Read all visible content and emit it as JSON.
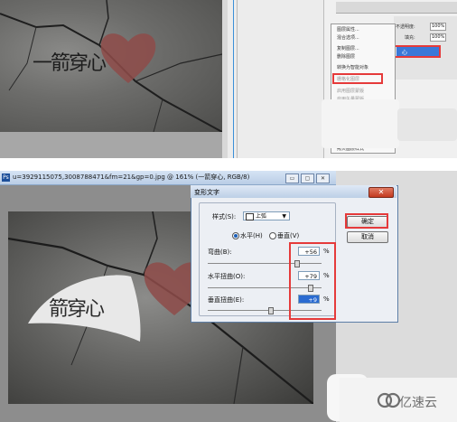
{
  "top": {
    "logo_text": "一箭穿心",
    "context_menu": {
      "items": [
        "图层属性...",
        "混合选项...",
        "复制图层...",
        "删除图层",
        "转换为智能对象",
        "栅格化图层",
        "启用图层蒙版",
        "启用矢量蒙版"
      ],
      "highlighted_item": "栅格化图层",
      "bottom_item": "拷贝图层样式"
    },
    "layers_panel": {
      "opacity_label": "不透明度:",
      "opacity_value": "100%",
      "fill_label": "填充:",
      "fill_value": "100%",
      "selected_layer": "心"
    }
  },
  "document": {
    "title": "u=3929115075,3008788471&fm=21&gp=0.jpg @ 161% (一箭穿心, RGB/8)",
    "window_buttons": [
      "▭",
      "▢",
      "✕"
    ],
    "logo_text": "箭穿心"
  },
  "warp_dialog": {
    "title": "变形文字",
    "style_label": "样式(S):",
    "style_value": "上弧",
    "horizontal_label": "水平(H)",
    "vertical_label": "垂直(V)",
    "orientation_selected": "horizontal",
    "bend_label": "弯曲(B):",
    "bend_value": "+56",
    "hdist_label": "水平扭曲(O):",
    "hdist_value": "+79",
    "vdist_label": "垂直扭曲(E):",
    "vdist_value": "+9",
    "percent": "%",
    "ok_label": "确定",
    "cancel_label": "取消",
    "bend_level_pct": 56,
    "hdist_level_pct": 79,
    "vdist_level_pct": 9
  },
  "watermark": {
    "text": "亿速云"
  },
  "colors": {
    "highlight_box": "#e53a3a",
    "selection_blue": "#3a78d8"
  }
}
